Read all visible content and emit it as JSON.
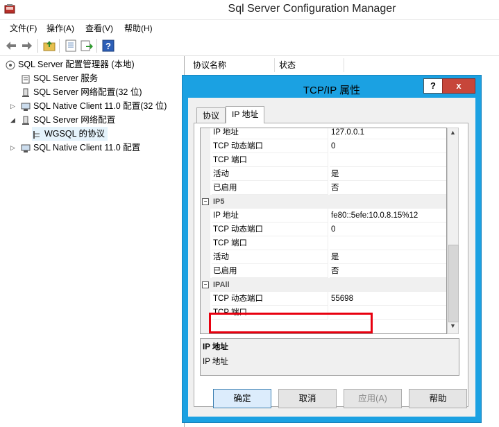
{
  "window": {
    "title": "Sql Server Configuration Manager",
    "menu": [
      "文件(F)",
      "操作(A)",
      "查看(V)",
      "帮助(H)"
    ],
    "toolbar_icons": [
      "back-arrow-icon",
      "forward-arrow-icon",
      "up-folder-icon",
      "properties-icon",
      "export-icon",
      "help-icon"
    ]
  },
  "tree": {
    "items": [
      {
        "label": "SQL Server 配置管理器 (本地)",
        "icon": "sql-config-manager-icon",
        "expander": ""
      },
      {
        "label": "SQL Server 服务",
        "icon": "service-icon",
        "expander": ""
      },
      {
        "label": "SQL Server 网络配置(32 位)",
        "icon": "network-config-icon",
        "expander": ""
      },
      {
        "label": "SQL Native Client 11.0 配置(32 位)",
        "icon": "client-config-icon",
        "expander": "▷"
      },
      {
        "label": "SQL Server 网络配置",
        "icon": "network-config-icon",
        "expander": "◢"
      },
      {
        "label": "WGSQL 的协议",
        "icon": "protocol-icon",
        "expander": ""
      },
      {
        "label": "SQL Native Client 11.0 配置",
        "icon": "client-config-icon",
        "expander": "▷"
      }
    ]
  },
  "list": {
    "columns": [
      "协议名称",
      "状态"
    ]
  },
  "dialog": {
    "title": "TCP/IP 属性",
    "help_glyph": "?",
    "close_glyph": "x",
    "tabs": [
      "协议",
      "IP 地址"
    ],
    "grid": {
      "rows": [
        {
          "type": "prop",
          "key": "IP 地址",
          "value": "127.0.0.1"
        },
        {
          "type": "prop",
          "key": "TCP 动态端口",
          "value": "0"
        },
        {
          "type": "prop",
          "key": "TCP 端口",
          "value": ""
        },
        {
          "type": "prop",
          "key": "活动",
          "value": "是"
        },
        {
          "type": "prop",
          "key": "已启用",
          "value": "否"
        },
        {
          "type": "cat",
          "key": "IP5",
          "toggle": "−"
        },
        {
          "type": "prop",
          "key": "IP 地址",
          "value": "fe80::5efe:10.0.8.15%12"
        },
        {
          "type": "prop",
          "key": "TCP 动态端口",
          "value": "0"
        },
        {
          "type": "prop",
          "key": "TCP 端口",
          "value": ""
        },
        {
          "type": "prop",
          "key": "活动",
          "value": "是"
        },
        {
          "type": "prop",
          "key": "已启用",
          "value": "否"
        },
        {
          "type": "cat",
          "key": "IPAll",
          "toggle": "−"
        },
        {
          "type": "prop",
          "key": "TCP 动态端口",
          "value": "55698"
        },
        {
          "type": "prop",
          "key": "TCP 端口",
          "value": ""
        }
      ]
    },
    "description": {
      "title": "IP 地址",
      "text": "IP 地址"
    },
    "buttons": {
      "ok": "确定",
      "cancel": "取消",
      "apply": "应用(A)",
      "help": "帮助"
    }
  }
}
